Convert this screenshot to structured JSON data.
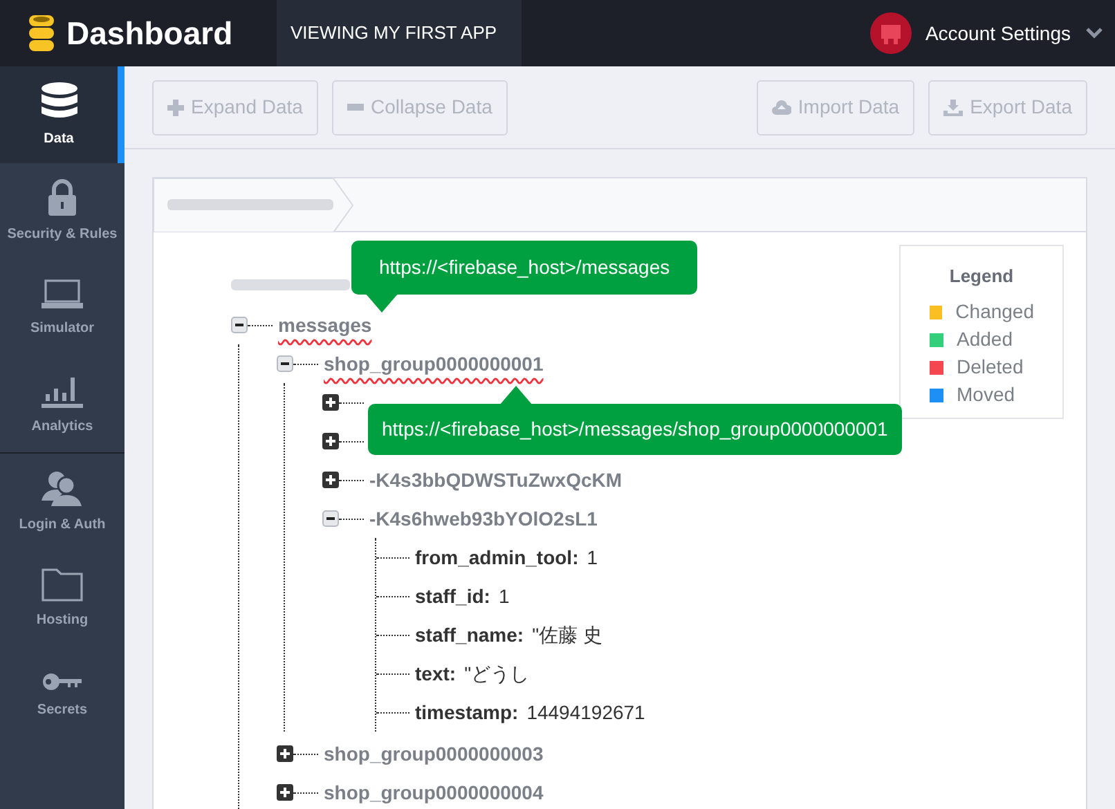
{
  "header": {
    "title": "Dashboard",
    "app_tab": "VIEWING MY FIRST APP",
    "account": "Account Settings"
  },
  "sidebar": {
    "items": [
      {
        "label": "Data",
        "selected": true
      },
      {
        "label": "Security & Rules",
        "selected": false
      },
      {
        "label": "Simulator",
        "selected": false
      },
      {
        "label": "Analytics",
        "selected": false
      },
      {
        "label": "Login & Auth",
        "selected": false
      },
      {
        "label": "Hosting",
        "selected": false
      },
      {
        "label": "Secrets",
        "selected": false
      }
    ]
  },
  "toolbar": {
    "buttons": [
      {
        "label": "Expand Data",
        "disabled": true
      },
      {
        "label": "Collapse Data",
        "disabled": true
      }
    ],
    "right_buttons": [
      {
        "label": "Import Data",
        "disabled": true
      },
      {
        "label": "Export Data",
        "disabled": true
      }
    ]
  },
  "tree": {
    "root": {
      "kind": "blurred"
    },
    "nodes": [
      {
        "key": "messages",
        "expanded": true,
        "marked": true,
        "children": [
          {
            "key": "shop_group0000000001",
            "expanded": true,
            "marked": true,
            "children": [
              {
                "expanded": false
              },
              {
                "expanded": false
              },
              {
                "key": "-K4s3bbQDWSTuZwxQcKM",
                "expanded": false
              },
              {
                "key": "-K4s6hweb93bYOlO2sL1",
                "expanded": true,
                "children": [
                  {
                    "key": "from_admin_tool:",
                    "value": "1"
                  },
                  {
                    "key": "staff_id:",
                    "value": "1"
                  },
                  {
                    "key": "staff_name:",
                    "value": "\"佐藤 史"
                  },
                  {
                    "key": "text:",
                    "value": "\"どうし"
                  },
                  {
                    "key": "timestamp:",
                    "value": "14494192671"
                  }
                ]
              }
            ]
          },
          {
            "key": "shop_group0000000003",
            "expanded": false
          },
          {
            "key": "shop_group0000000004",
            "expanded": false
          }
        ]
      }
    ]
  },
  "tooltips": [
    "https://<firebase_host>/messages",
    "https://<firebase_host>/messages/shop_group0000000001"
  ],
  "legend": {
    "title": "Legend",
    "items": [
      {
        "label": "Changed",
        "color": "#fbbf24"
      },
      {
        "label": "Added",
        "color": "#34cf7a"
      },
      {
        "label": "Deleted",
        "color": "#f5474f"
      },
      {
        "label": "Moved",
        "color": "#1e90f5"
      }
    ]
  }
}
